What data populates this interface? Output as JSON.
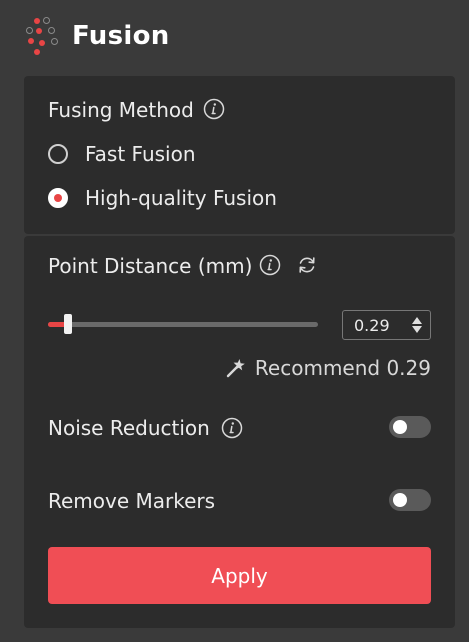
{
  "header": {
    "title": "Fusion"
  },
  "fusing": {
    "label": "Fusing Method",
    "options": [
      {
        "label": "Fast Fusion",
        "selected": false
      },
      {
        "label": "High-quality Fusion",
        "selected": true
      }
    ]
  },
  "point_distance": {
    "label": "Point Distance (mm)",
    "value": "0.29",
    "slider_fraction": 0.075,
    "recommend_label": "Recommend 0.29"
  },
  "noise_reduction": {
    "label": "Noise Reduction",
    "enabled": false
  },
  "remove_markers": {
    "label": "Remove Markers",
    "enabled": false
  },
  "apply_label": "Apply",
  "colors": {
    "accent": "#f04e55",
    "panel": "#2c2c2c",
    "background": "#3a3a3a"
  },
  "icons": [
    "fusion-logo-icon",
    "info-icon",
    "refresh-icon",
    "magic-wand-icon"
  ]
}
